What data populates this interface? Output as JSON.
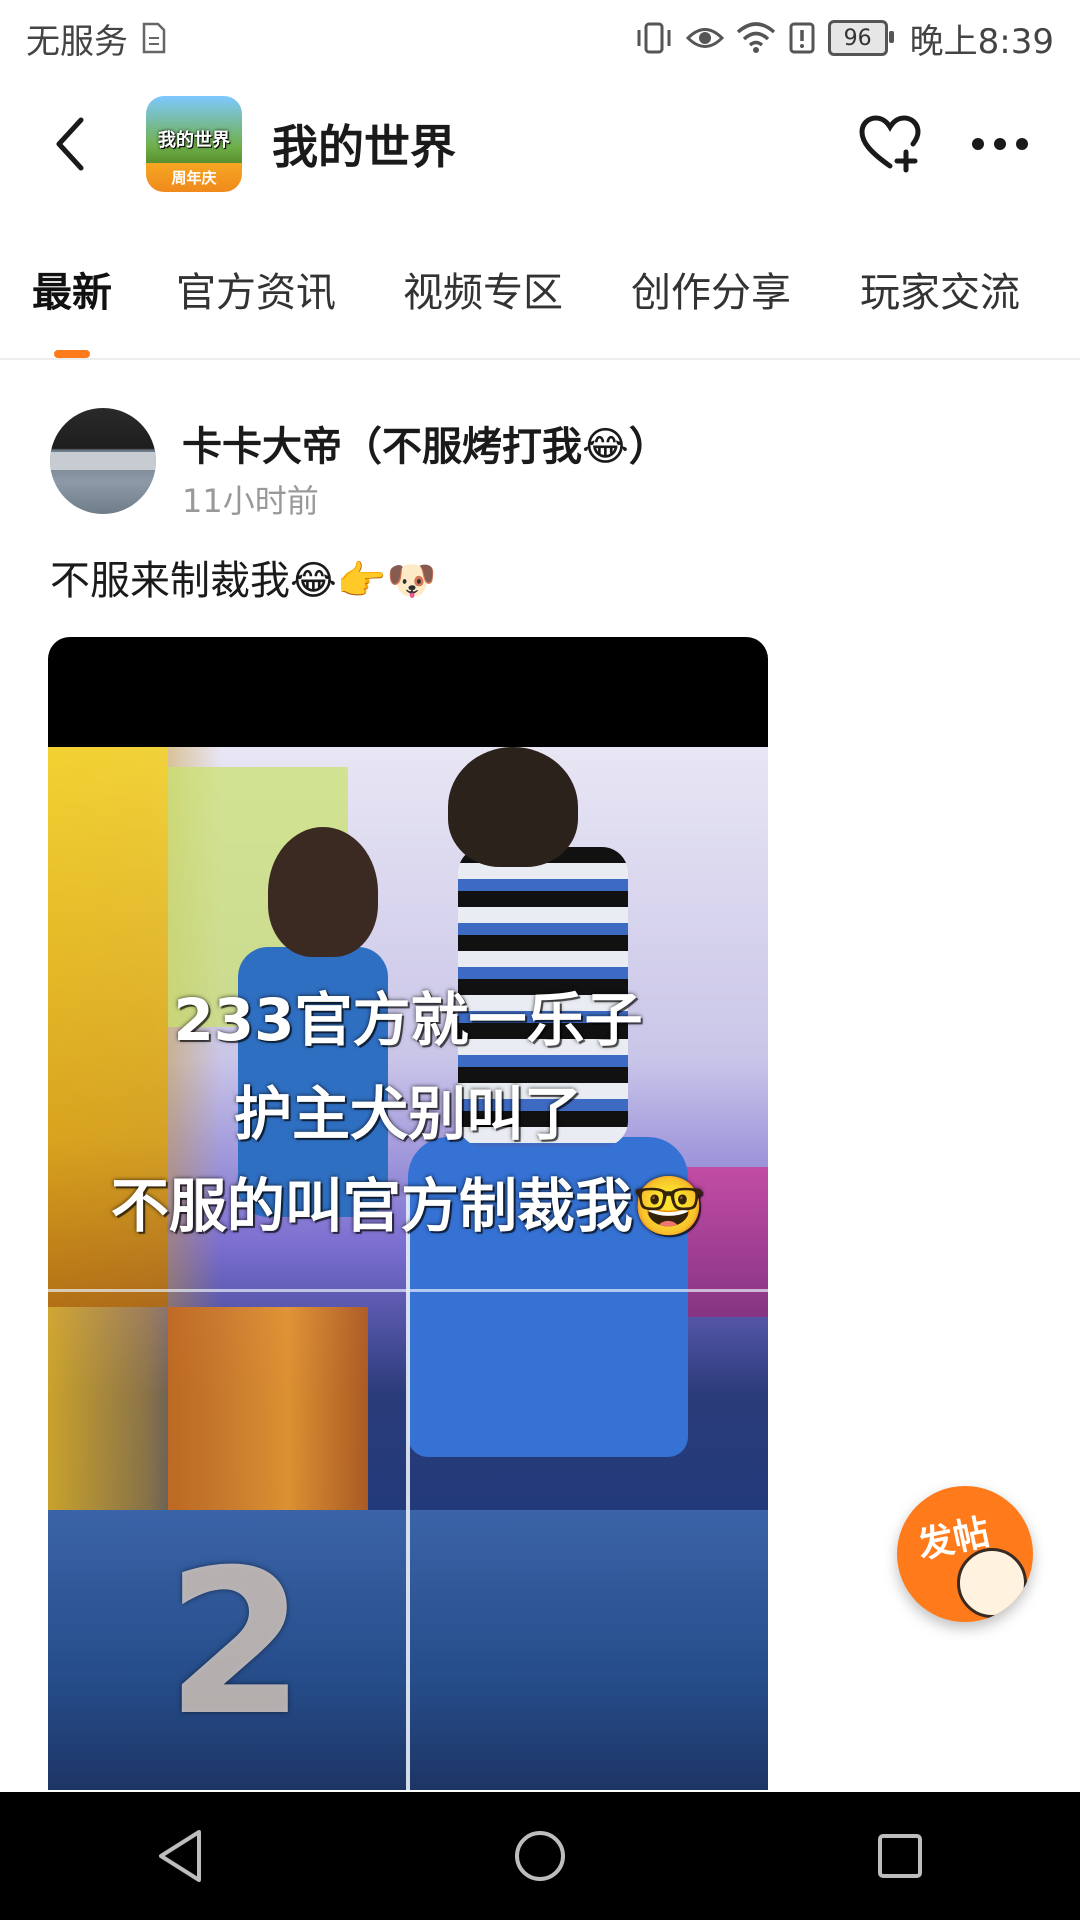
{
  "status_bar": {
    "carrier": "无服务",
    "battery_level": "96",
    "time": "晚上8:39"
  },
  "header": {
    "app_title": "我的世界",
    "logo_text": "我的世界",
    "logo_badge": "周年庆"
  },
  "tabs": [
    {
      "label": "最新",
      "active": true
    },
    {
      "label": "官方资讯",
      "active": false
    },
    {
      "label": "视频专区",
      "active": false
    },
    {
      "label": "创作分享",
      "active": false
    },
    {
      "label": "玩家交流",
      "active": false
    }
  ],
  "post": {
    "author": "卡卡大帝（不服烤打我😂）",
    "time": "11小时前",
    "text": "不服来制裁我😂👉🐶",
    "image_overlay": {
      "line1": "233官方就一乐子",
      "line2": "护主犬别叫了",
      "line3": "不服的叫官方制裁我🤓",
      "number": "2"
    }
  },
  "fab": {
    "label": "发帖"
  },
  "colors": {
    "accent": "#ff7a1a",
    "nav_bg": "#000000"
  }
}
